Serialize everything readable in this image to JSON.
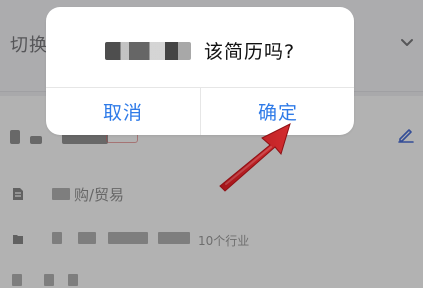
{
  "background": {
    "switch_label": "切换",
    "list_items": [
      {
        "text_suffix": "购/贸易"
      },
      {
        "text_suffix": "10个行业"
      }
    ]
  },
  "alert": {
    "title_suffix": "该简历吗?",
    "cancel_label": "取消",
    "confirm_label": "确定"
  },
  "colors": {
    "primary_button": "#2f7be8",
    "annotation_arrow": "#c91f1f"
  },
  "icons": {
    "chevron": "chevron-down-icon",
    "edit": "edit-icon",
    "document": "document-icon",
    "folder": "folder-icon",
    "arrow": "annotation-arrow-icon"
  }
}
